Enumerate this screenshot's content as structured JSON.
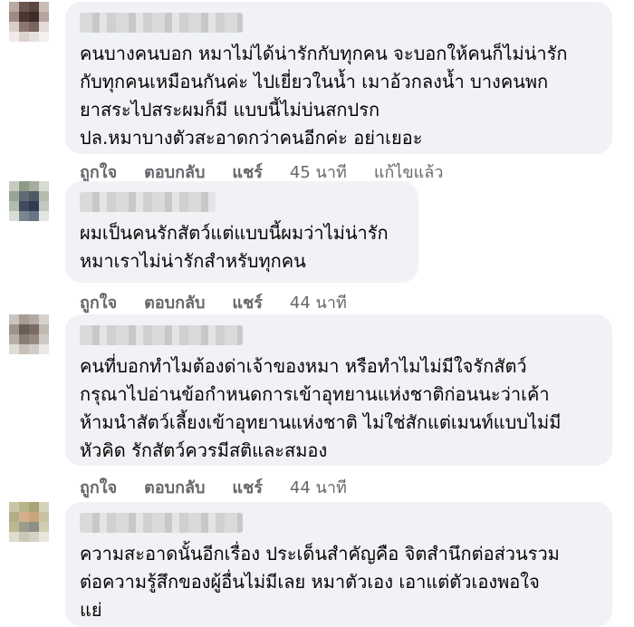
{
  "comments": [
    {
      "text": "คนบางคนบอก หมาไม่ได้น่ารักกับทุกคน จะบอกให้คนก็ไม่น่ารัก\nกับทุกคนเหมือนกันค่ะ ไปเยี่ยวในน้ำ เมาอ้วกลงน้ำ บางคนพก\nยาสระไปสระผมก็มี แบบนี้ไม่บ่นสกปรก\nปล.หมาบางตัวสะอาดกว่าคนอีกค่ะ อย่าเยอะ",
      "like": "ถูกใจ",
      "reply": "ตอบกลับ",
      "share": "แชร์",
      "time": "45 นาที",
      "edited": "แก้ไขแล้ว"
    },
    {
      "text": "ผมเป็นคนรักสัตว์แต่แบบนี้ผมว่าไม่น่ารัก\nหมาเราไม่น่ารักสำหรับทุกคน",
      "like": "ถูกใจ",
      "reply": "ตอบกลับ",
      "share": "แชร์",
      "time": "44 นาที"
    },
    {
      "text": "คนที่บอกทำไมต้องด่าเจ้าของหมา หรือทำไมไม่มีใจรักสัตว์\nกรุณาไปอ่านข้อกำหนดการเข้าอุทยานแห่งชาติก่อนนะว่าเค้า\nห้ามนำสัตว์เลี้ยงเข้าอุทยานแห่งชาติ ไม่ใช่สักแต่เมนท์แบบไม่มี\nหัวคิด รักสัตว์ควรมีสติและสมอง",
      "like": "ถูกใจ",
      "reply": "ตอบกลับ",
      "share": "แชร์",
      "time": "44 นาที"
    },
    {
      "text": "ความสะอาดนั้นอีกเรื่อง ประเด็นสำคัญคือ จิตสำนึกต่อส่วนรวม\nต่อความรู้สึกของผู้อื่นไม่มีเลย หมาตัวเอง เอาแต่ตัวเองพอใจ\nแย่"
    }
  ],
  "colors": {
    "bubble": "#f0f2f5",
    "action_text": "#65676b",
    "body_text": "#050505"
  }
}
